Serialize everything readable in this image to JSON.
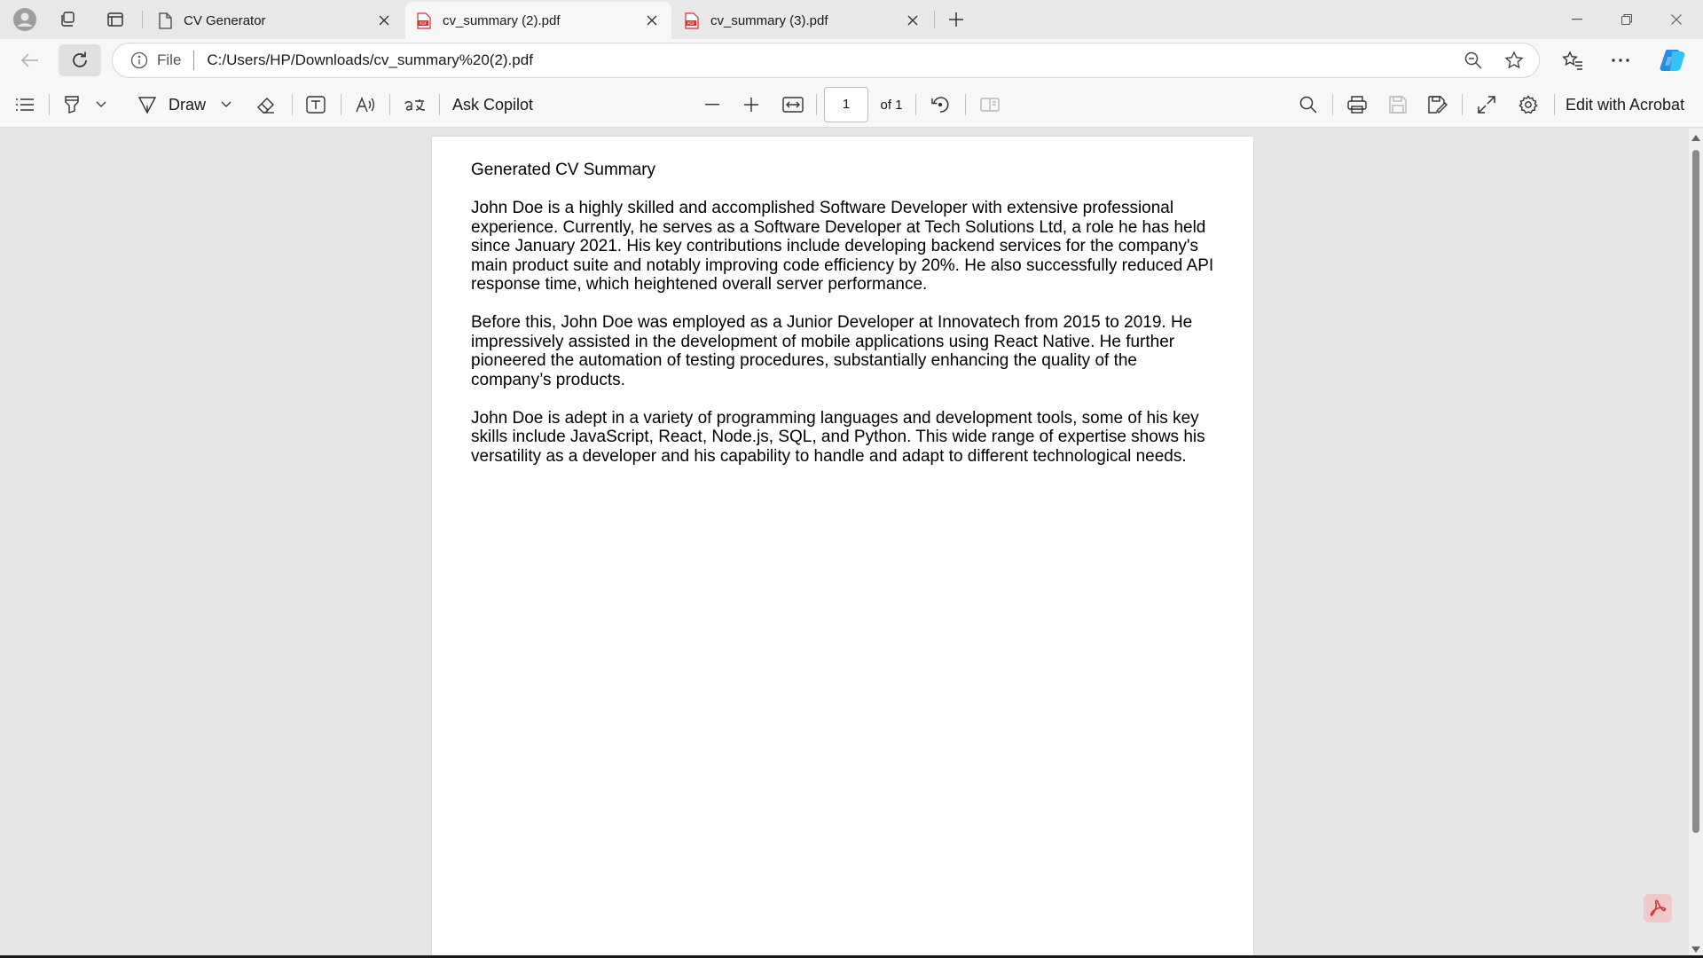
{
  "tabs": [
    {
      "title": "CV Generator",
      "favicon": "document-icon",
      "active": false
    },
    {
      "title": "cv_summary (2).pdf",
      "favicon": "pdf-icon",
      "active": true
    },
    {
      "title": "cv_summary (3).pdf",
      "favicon": "pdf-icon",
      "active": false
    }
  ],
  "address": {
    "scheme_label": "File",
    "url": "C:/Users/HP/Downloads/cv_summary%20(2).pdf"
  },
  "pdf_toolbar": {
    "draw_label": "Draw",
    "ask_copilot_label": "Ask Copilot",
    "page_current": "1",
    "page_of": "of 1",
    "edit_acrobat_label": "Edit with Acrobat"
  },
  "document": {
    "title": "Generated CV Summary",
    "paragraphs": [
      "John Doe is a highly skilled and accomplished Software Developer with extensive professional experience. Currently, he serves as a Software Developer at Tech Solutions Ltd, a role he has held since January 2021. His key contributions include developing backend services for the company's main product suite and notably improving code efficiency by 20%. He also successfully reduced API response time, which heightened overall server performance.",
      "Before this, John Doe was employed as a Junior Developer at Innovatech from 2015 to 2019. He impressively assisted in the development of mobile applications using React Native. He further pioneered the automation of testing procedures, substantially enhancing the quality of the company’s products.",
      "John Doe is adept in a variety of programming languages and development tools, some of his key skills include JavaScript, React, Node.js, SQL, and Python. This wide range of expertise shows his versatility as a developer and his capability to handle and adapt to different technological needs."
    ]
  },
  "colors": {
    "copilot_accent": "#1f8fe8",
    "pdf_red": "#d32f2f"
  }
}
